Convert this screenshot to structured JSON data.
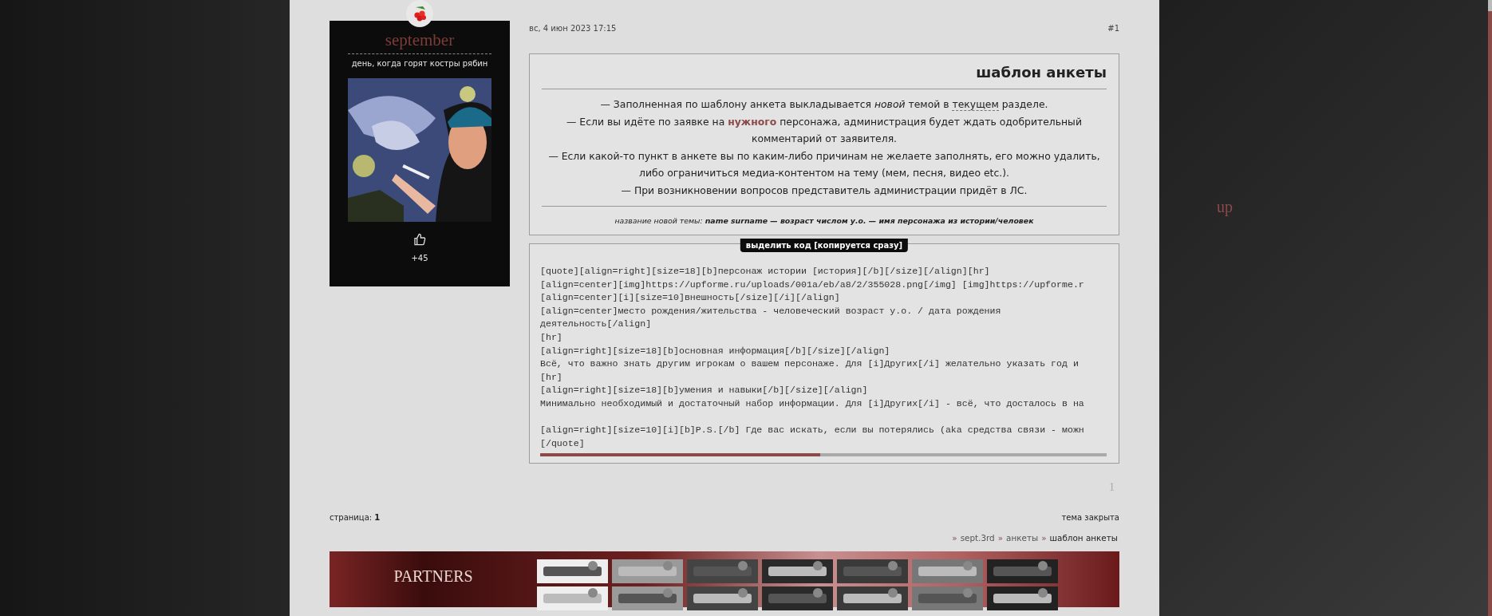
{
  "post": {
    "date": "вс, 4 июн 2023 17:15",
    "number": "#1",
    "author": {
      "name": "september",
      "status": "день, когда горят костры рябин",
      "likes": "+45"
    },
    "template": {
      "title": "шаблон анкеты",
      "paragraphs": [
        [
          {
            "kind": "plain",
            "text": "— Заполненная по шаблону анкета выкладывается "
          },
          {
            "kind": "italic",
            "text": "новой"
          },
          {
            "kind": "plain",
            "text": " темой в "
          },
          {
            "kind": "abbr",
            "text": "текущем"
          },
          {
            "kind": "plain",
            "text": " разделе."
          }
        ],
        [
          {
            "kind": "plain",
            "text": "— Если вы идёте по заявке на "
          },
          {
            "kind": "accent",
            "text": "нужного"
          },
          {
            "kind": "plain",
            "text": " персонажа, администрация будет ждать одобрительный комментарий от заявителя."
          }
        ],
        [
          {
            "kind": "plain",
            "text": "— Если какой-то пункт в анкете вы по каким-либо причинам не желаете заполнять, его можно удалить, либо ограничиться медиа-контентом на тему (мем, песня, видео etc.)."
          }
        ],
        [
          {
            "kind": "plain",
            "text": "— При возникновении вопросов представитель администрации придёт в ЛС."
          }
        ]
      ],
      "note": "название новой темы: **name surname — возраст числом у.о. — имя персонажа из истории/человек**"
    },
    "code": {
      "label": "выделить код [копируется сразу]",
      "text": "[quote][align=right][size=18][b]персонаж истории [история][/b][/size][/align][hr]\n[align=center][img]https://upforme.ru/uploads/001a/eb/a8/2/355028.png[/img] [img]https://upforme.r\n[align=center][i][size=10]внешность[/size][/i][/align]\n[align=center]место рождения/жительства - человеческий возраст у.о. / дата рождения\nдеятельность[/align]\n[hr]\n[align=right][size=18][b]основная информация[/b][/size][/align]\nВсё, что важно знать другим игрокам о вашем персонаже. Для [i]Других[/i] желательно указать год и\n[hr]\n[align=right][size=18][b]умения и навыки[/b][/size][/align]\nМинимально необходимый и достаточный набор информации. Для [i]Других[/i] - всё, что досталось в на\n\n[align=right][size=10][i][b]P.S.[/b] Где вас искать, если вы потерялись (aka средства связи - можн\n[/quote]"
    },
    "page_number": "1"
  },
  "pagination": {
    "label": "страница:",
    "current": "1"
  },
  "topic_status": "тема закрыта",
  "breadcrumbs": [
    {
      "sep": "»",
      "label": "sept.3rd",
      "current": false
    },
    {
      "sep": "»",
      "label": "анкеты",
      "current": false
    },
    {
      "sep": "»",
      "label": "шаблон анкеты",
      "current": true
    }
  ],
  "partners": {
    "title": "PARTNERS"
  },
  "up_link": "up"
}
